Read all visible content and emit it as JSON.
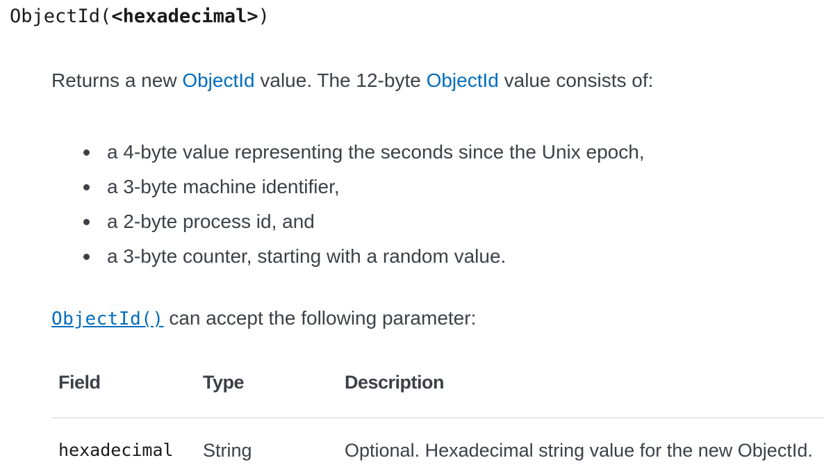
{
  "signature": {
    "name": "ObjectId(",
    "param": "<hexadecimal>",
    "close": ")"
  },
  "intro": {
    "prefix": "Returns a new ",
    "link1": "ObjectId",
    "middle": " value. The 12-byte ",
    "link2": "ObjectId",
    "suffix": " value consists of:"
  },
  "bullets": [
    "a 4-byte value representing the seconds since the Unix epoch,",
    "a 3-byte machine identifier,",
    "a 2-byte process id, and",
    "a 3-byte counter, starting with a random value."
  ],
  "accept": {
    "code_link": "ObjectId()",
    "text": " can accept the following parameter:"
  },
  "table": {
    "headers": [
      "Field",
      "Type",
      "Description"
    ],
    "rows": [
      {
        "field": "hexadecimal",
        "type": "String",
        "description": "Optional. Hexadecimal string value for the new ObjectId."
      }
    ]
  },
  "colors": {
    "link": "#006cbc",
    "text": "#3d4047",
    "divider": "#e6e6e6"
  }
}
